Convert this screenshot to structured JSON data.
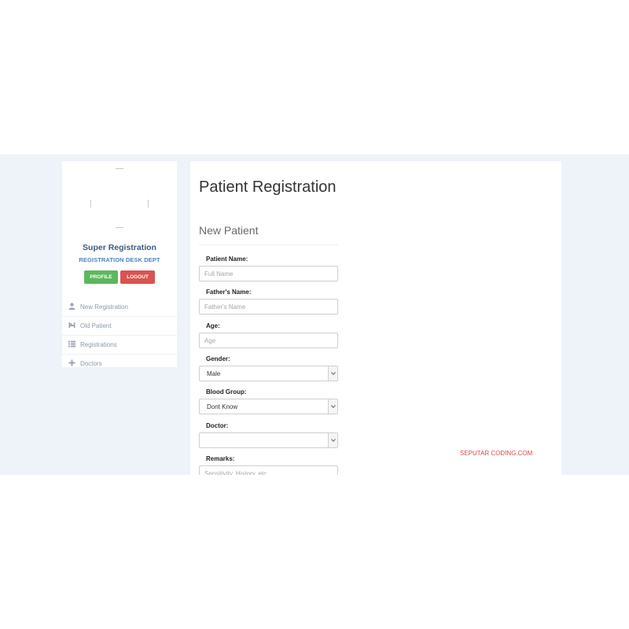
{
  "sidebar": {
    "user_name": "Super Registration",
    "department": "REGISTRATION DESK DEPT",
    "profile_button": "PROFILE",
    "logout_button": "LOGOUT",
    "items": [
      {
        "label": "New Registration",
        "icon": "user-icon"
      },
      {
        "label": "Old Patient",
        "icon": "bed-icon"
      },
      {
        "label": "Registrations",
        "icon": "list-icon"
      },
      {
        "label": "Doctors",
        "icon": "plus-icon"
      }
    ]
  },
  "main": {
    "title": "Patient Registration",
    "section_title": "New Patient",
    "fields": {
      "patient_name": {
        "label": "Patient Name:",
        "placeholder": "Full Name"
      },
      "father_name": {
        "label": "Father's Name:",
        "placeholder": "Father's Name"
      },
      "age": {
        "label": "Age:",
        "placeholder": "Age"
      },
      "gender": {
        "label": "Gender:",
        "value": "Male"
      },
      "blood_group": {
        "label": "Blood Group:",
        "value": "Dont Know"
      },
      "doctor": {
        "label": "Doctor:",
        "value": ""
      },
      "remarks": {
        "label": "Remarks:",
        "placeholder": "Sensitivity, History, etc."
      }
    },
    "watermark": "SEPUTAR CODING.COM"
  },
  "colors": {
    "background": "#eef3fa",
    "profile_button": "#5cb85c",
    "logout_button": "#d9534f",
    "user_name": "#3b5b7e",
    "department": "#4b83c4",
    "watermark": "#e0464a"
  }
}
